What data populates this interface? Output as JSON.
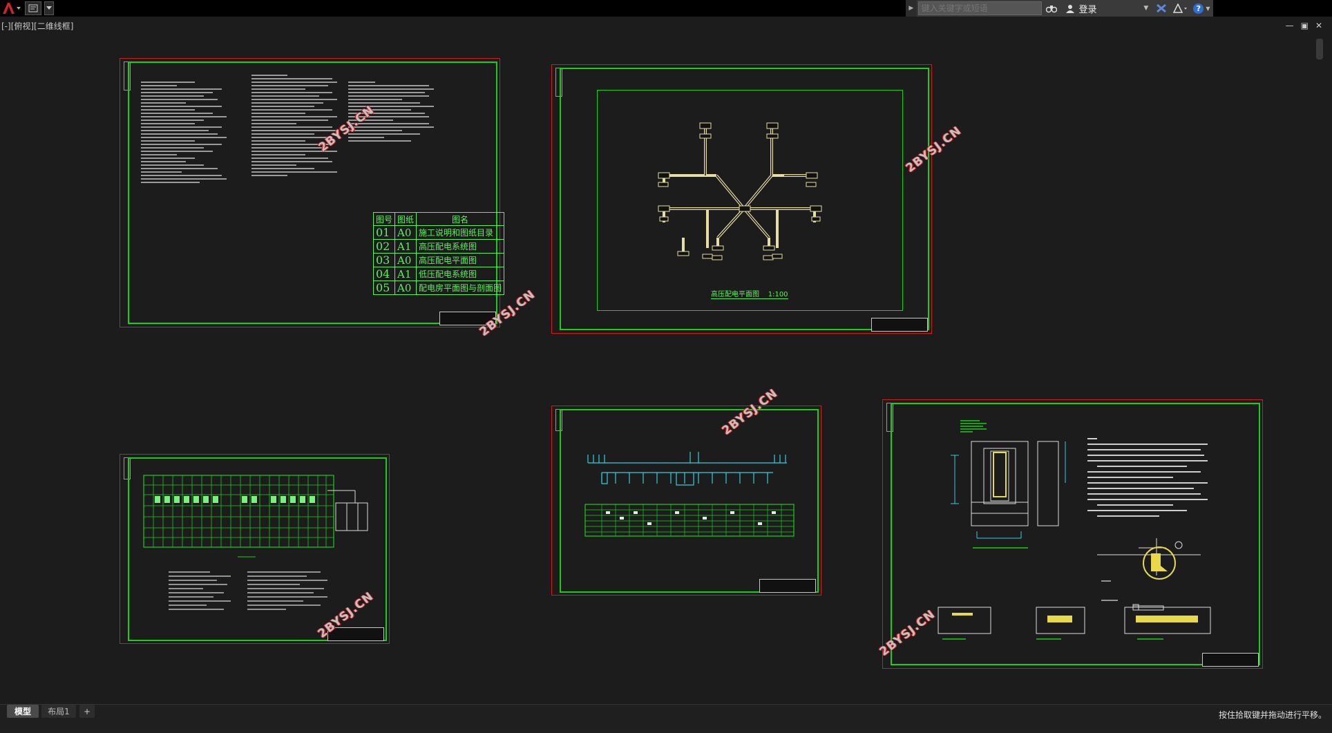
{
  "search": {
    "placeholder": "键入关键字或短语"
  },
  "toolbar": {
    "login_label": "登录",
    "help_label": "?"
  },
  "viewport": {
    "label": "[-][俯视][二维线框]"
  },
  "sheet1": {
    "index_header": [
      "图号",
      "图纸",
      "图名"
    ],
    "index_rows": [
      {
        "no": "01",
        "size": "A0",
        "name": "施工说明和图纸目录"
      },
      {
        "no": "02",
        "size": "A1",
        "name": "高压配电系统图"
      },
      {
        "no": "03",
        "size": "A0",
        "name": "高压配电平面图"
      },
      {
        "no": "04",
        "size": "A1",
        "name": "低压配电系统图"
      },
      {
        "no": "05",
        "size": "A0",
        "name": "配电房平面图与剖面图"
      }
    ]
  },
  "sheet2": {
    "drawing_title": "高压配电平面图",
    "scale": "1:100"
  },
  "watermark": "2BYSJ.CN",
  "tabs": [
    {
      "label": "模型"
    },
    {
      "label": "布局1"
    },
    {
      "label": "+"
    }
  ],
  "statusbar": {
    "message": "按住拾取键并拖动进行平移。"
  },
  "colors": {
    "frame_red": "#d21a1a",
    "frame_green": "#18d018",
    "background": "#1c1c1c",
    "cad_yellow": "#e8e0a0",
    "cad_cyan": "#2fd0e0"
  }
}
